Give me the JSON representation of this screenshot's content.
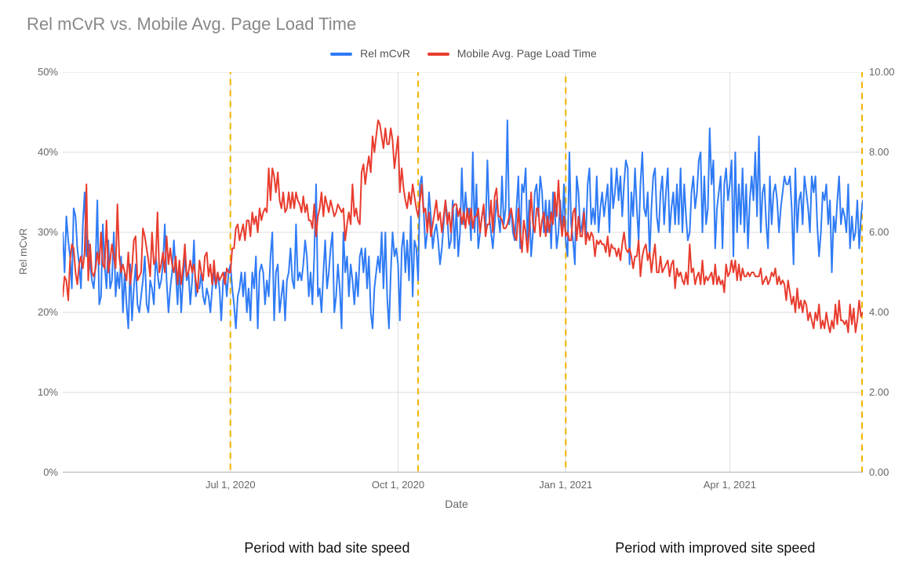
{
  "chart_data": {
    "type": "line",
    "title": "Rel mCvR vs. Mobile Avg. Page Load Time",
    "xlabel": "Date",
    "ylabel": "Rel mCvR",
    "y2label": "",
    "ylim": [
      0,
      50
    ],
    "y2lim": [
      0,
      10
    ],
    "y_ticks": [
      "0%",
      "10%",
      "20%",
      "30%",
      "40%",
      "50%"
    ],
    "y2_ticks": [
      "0.00",
      "2.00",
      "4.00",
      "6.00",
      "8.00",
      "10.00"
    ],
    "x_ticks": [
      {
        "label": "Jul 1, 2020",
        "idx": 92
      },
      {
        "label": "Oct 1, 2020",
        "idx": 184
      },
      {
        "label": "Jan 1, 2021",
        "idx": 276
      },
      {
        "label": "Apr 1, 2021",
        "idx": 366
      }
    ],
    "n_points": 440,
    "legend": [
      {
        "name": "Rel mCvR",
        "color": "#2f7bf5"
      },
      {
        "name": "Mobile Avg. Page Load Time",
        "color": "#e83c2e"
      }
    ],
    "series": [
      {
        "name": "Rel mCvR",
        "axis": "left",
        "color": "#2f7bf5",
        "values_note": "Percent values, 0–50 scale. Daily. Estimated off pixels.",
        "values": [
          30,
          25,
          32,
          29,
          27,
          23,
          33,
          32,
          28,
          26,
          23,
          31,
          35,
          27,
          29,
          26,
          24,
          23,
          26,
          34,
          21,
          22,
          31,
          26,
          23,
          29,
          23,
          24,
          30,
          22,
          25,
          23,
          27,
          20,
          25,
          21,
          18,
          26,
          19,
          23,
          26,
          21,
          20,
          22,
          24,
          27,
          21,
          20,
          24,
          23,
          21,
          27,
          25,
          23,
          24,
          26,
          31,
          24,
          20,
          23,
          25,
          29,
          25,
          21,
          26,
          20,
          24,
          27,
          24,
          25,
          21,
          24,
          29,
          22,
          23,
          23,
          25,
          22,
          21,
          23,
          22,
          20,
          23,
          25,
          23,
          25,
          23,
          19,
          24,
          25,
          22,
          25,
          26,
          23,
          21,
          18,
          22,
          23,
          25,
          22,
          25,
          20,
          23,
          19,
          25,
          23,
          27,
          18,
          25,
          26,
          25,
          21,
          24,
          22,
          27,
          30,
          19,
          25,
          26,
          20,
          22,
          24,
          19,
          24,
          25,
          28,
          24,
          23,
          31,
          24,
          25,
          24,
          26,
          29,
          27,
          22,
          25,
          21,
          27,
          36,
          22,
          23,
          20,
          25,
          29,
          23,
          25,
          28,
          30,
          20,
          22,
          26,
          23,
          18,
          30,
          25,
          27,
          22,
          26,
          24,
          21,
          25,
          22,
          27,
          28,
          25,
          28,
          23,
          27,
          20,
          18,
          23,
          25,
          27,
          25,
          30,
          23,
          30,
          22,
          18,
          25,
          30,
          27,
          28,
          26,
          19,
          28,
          30,
          25,
          29,
          24,
          32,
          22,
          29,
          28,
          24,
          36,
          37,
          33,
          28,
          30,
          35,
          32,
          28,
          30,
          31,
          29,
          26,
          28,
          31,
          34,
          32,
          28,
          29,
          34,
          28,
          33,
          27,
          30,
          38,
          31,
          35,
          32,
          33,
          29,
          40,
          30,
          36,
          28,
          30,
          32,
          33,
          30,
          39,
          32,
          30,
          28,
          31,
          34,
          32,
          30,
          37,
          31,
          33,
          44,
          31,
          33,
          30,
          29,
          33,
          37,
          28,
          36,
          35,
          38,
          29,
          34,
          27,
          30,
          35,
          36,
          32,
          37,
          35,
          30,
          34,
          30,
          34,
          28,
          35,
          33,
          28,
          30,
          34,
          30,
          36,
          29,
          27,
          40,
          31,
          29,
          26,
          37,
          35,
          30,
          31,
          33,
          29,
          36,
          38,
          31,
          33,
          31,
          37,
          30,
          33,
          35,
          32,
          34,
          36,
          30,
          38,
          33,
          35,
          38,
          34,
          37,
          32,
          36,
          39,
          38,
          26,
          35,
          32,
          38,
          33,
          29,
          36,
          40,
          33,
          32,
          35,
          27,
          33,
          37,
          38,
          32,
          30,
          35,
          37,
          31,
          35,
          38,
          30,
          33,
          35,
          31,
          36,
          31,
          38,
          30,
          36,
          32,
          29,
          30,
          35,
          37,
          33,
          35,
          39,
          40,
          30,
          37,
          31,
          33,
          43,
          36,
          39,
          28,
          33,
          35,
          37,
          28,
          36,
          38,
          34,
          36,
          39,
          27,
          40,
          30,
          36,
          31,
          38,
          30,
          36,
          28,
          34,
          37,
          34,
          40,
          32,
          42,
          30,
          35,
          36,
          31,
          28,
          37,
          31,
          35,
          36,
          34,
          30,
          33,
          35,
          37,
          36,
          36,
          37,
          33,
          26,
          38,
          30,
          34,
          35,
          31,
          37,
          35,
          33,
          30,
          37,
          35,
          37,
          31,
          27,
          30,
          35,
          34,
          36,
          31,
          34,
          25,
          32,
          30,
          34,
          37,
          31,
          33,
          32,
          30,
          36,
          28,
          32,
          29,
          30,
          34,
          28,
          32,
          34
        ]
      },
      {
        "name": "Mobile Avg. Page Load Time",
        "axis": "right",
        "color": "#e83c2e",
        "values_note": "Seconds, 0–10 scale. Daily. Estimated off pixels.",
        "values": [
          4.4,
          4.9,
          4.8,
          4.3,
          5.3,
          5.7,
          5.6,
          5.0,
          4.7,
          5.2,
          5.4,
          5.1,
          5.5,
          7.2,
          4.8,
          5.7,
          5.0,
          4.9,
          5.1,
          5.5,
          5.2,
          6.0,
          5.2,
          5.1,
          6.3,
          5.0,
          5.3,
          5.7,
          5.4,
          5.1,
          6.7,
          5.4,
          5.0,
          5.2,
          5.0,
          4.8,
          5.5,
          4.7,
          5.1,
          5.8,
          5.9,
          4.8,
          4.9,
          5.0,
          6.1,
          5.9,
          5.6,
          5.3,
          4.9,
          6.0,
          5.2,
          5.3,
          6.5,
          5.0,
          5.2,
          5.5,
          5.0,
          5.9,
          5.2,
          5.6,
          5.2,
          5.0,
          5.4,
          4.7,
          5.3,
          4.7,
          5.1,
          5.7,
          4.9,
          5.0,
          5.3,
          5.0,
          5.2,
          4.8,
          4.5,
          5.3,
          5.0,
          4.8,
          5.4,
          5.5,
          4.9,
          5.2,
          4.7,
          5.3,
          4.7,
          5.0,
          4.8,
          4.9,
          5.0,
          4.7,
          5.1,
          5.0,
          5.0,
          5.6,
          5.6,
          6.1,
          6.2,
          5.8,
          6.0,
          6.2,
          5.8,
          6.3,
          6.3,
          5.9,
          6.5,
          6.2,
          6.4,
          6.0,
          6.6,
          6.3,
          6.5,
          6.6,
          6.5,
          7.6,
          6.8,
          7.6,
          7.4,
          7.0,
          7.5,
          6.8,
          6.6,
          7.0,
          6.5,
          6.6,
          7.0,
          6.6,
          7.0,
          6.6,
          7.0,
          6.8,
          6.7,
          6.5,
          6.9,
          6.5,
          6.7,
          6.3,
          6.3,
          6.1,
          6.7,
          5.9,
          6.4,
          6.6,
          7.0,
          6.4,
          6.9,
          6.7,
          6.5,
          6.8,
          6.6,
          6.4,
          6.5,
          6.7,
          6.6,
          6.5,
          6.6,
          5.8,
          6.2,
          6.5,
          6.2,
          7.2,
          6.4,
          6.6,
          6.3,
          6.2,
          7.5,
          7.7,
          7.2,
          7.6,
          7.9,
          7.5,
          8.4,
          8.0,
          8.4,
          8.8,
          8.7,
          8.4,
          8.1,
          8.6,
          8.2,
          8.2,
          8.6,
          8.3,
          7.6,
          8.0,
          8.4,
          7.0,
          7.6,
          7.1,
          6.8,
          6.6,
          7.0,
          6.7,
          7.2,
          6.9,
          6.6,
          6.4,
          6.8,
          7.2,
          6.5,
          6.6,
          6.0,
          6.5,
          5.9,
          6.2,
          6.5,
          6.8,
          6.3,
          6.5,
          6.0,
          6.4,
          6.8,
          6.2,
          6.5,
          6.0,
          6.6,
          6.7,
          6.7,
          6.4,
          6.6,
          6.2,
          6.5,
          6.1,
          6.6,
          6.2,
          6.6,
          6.1,
          6.4,
          6.4,
          6.6,
          6.0,
          6.4,
          6.7,
          5.9,
          6.2,
          6.2,
          6.8,
          6.0,
          6.9,
          7.1,
          6.4,
          6.4,
          6.3,
          6.1,
          6.1,
          6.2,
          6.4,
          6.6,
          6.3,
          5.9,
          5.8,
          6.6,
          6.0,
          5.5,
          6.3,
          6.0,
          5.5,
          6.1,
          7.0,
          6.2,
          6.0,
          6.6,
          6.6,
          5.9,
          6.3,
          6.5,
          5.9,
          6.4,
          6.0,
          6.5,
          6.2,
          7.0,
          6.4,
          7.3,
          6.4,
          5.9,
          6.4,
          5.9,
          6.0,
          5.8,
          5.8,
          6.5,
          6.6,
          5.8,
          6.4,
          5.9,
          5.9,
          6.5,
          5.7,
          6.0,
          5.8,
          6.0,
          5.9,
          5.4,
          5.8,
          5.7,
          5.8,
          5.7,
          5.7,
          5.5,
          5.9,
          5.4,
          5.7,
          5.6,
          5.6,
          5.4,
          5.6,
          5.3,
          5.7,
          6.0,
          5.6,
          5.5,
          5.6,
          5.4,
          5.1,
          5.4,
          5.4,
          5.8,
          4.9,
          5.4,
          5.6,
          5.7,
          5.3,
          5.5,
          5.0,
          5.4,
          5.7,
          5.0,
          5.0,
          5.4,
          5.0,
          5.1,
          5.2,
          5.3,
          4.9,
          5.2,
          5.3,
          4.6,
          5.1,
          4.9,
          5.0,
          4.8,
          4.7,
          5.0,
          4.7,
          5.7,
          5.0,
          5.1,
          4.7,
          4.9,
          5.0,
          4.7,
          5.3,
          4.7,
          4.9,
          4.8,
          4.9,
          5.0,
          4.7,
          5.2,
          4.7,
          4.9,
          4.7,
          4.8,
          4.5,
          5.2,
          4.9,
          5.0,
          5.3,
          5.0,
          5.3,
          4.8,
          5.2,
          4.8,
          5.1,
          4.9,
          4.9,
          5.0,
          4.9,
          5.0,
          5.0,
          4.9,
          4.9,
          4.9,
          5.1,
          4.7,
          4.8,
          4.9,
          4.7,
          4.8,
          5.0,
          4.9,
          5.1,
          4.7,
          4.9,
          4.7,
          4.8,
          4.7,
          4.3,
          4.8,
          4.5,
          4.2,
          4.4,
          4.0,
          4.6,
          4.1,
          4.3,
          4.0,
          4.3,
          4.2,
          3.8,
          4.0,
          3.8,
          3.6,
          4.0,
          3.8,
          4.2,
          3.6,
          3.8,
          3.6,
          4.0,
          3.7,
          3.5,
          3.8,
          3.6,
          4.2,
          3.7,
          4.3,
          3.8,
          3.8,
          3.7,
          3.8,
          3.5,
          4.2,
          3.7,
          4.1,
          3.5,
          3.8,
          4.3,
          3.9,
          4.0
        ]
      }
    ],
    "highlight_regions": [
      {
        "x0": 92,
        "x1": 195,
        "label": "Period with bad site speed"
      },
      {
        "x0": 276,
        "x1": 440,
        "label": "Period with improved site speed"
      }
    ],
    "annotations": [
      {
        "text": "Period with bad site speed",
        "center_idx": 145
      },
      {
        "text": "Period with improved site speed",
        "center_idx": 358
      }
    ]
  }
}
